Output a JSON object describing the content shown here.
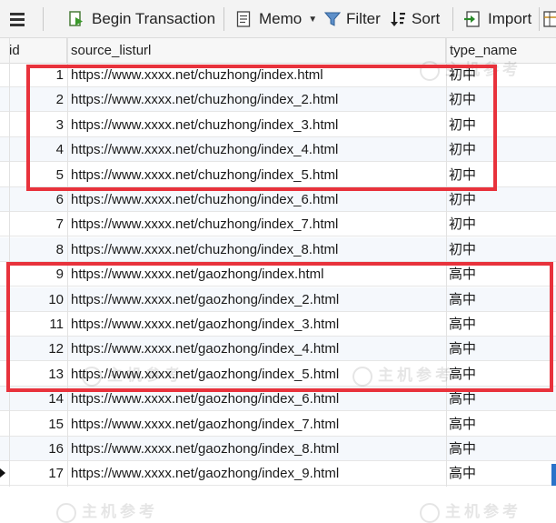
{
  "toolbar": {
    "begin_transaction": "Begin Transaction",
    "memo": "Memo",
    "filter": "Filter",
    "sort": "Sort",
    "import": "Import"
  },
  "columns": [
    "id",
    "source_listurl",
    "type_name"
  ],
  "rows": [
    {
      "id": "1",
      "url": "https://www.xxxx.net/chuzhong/index.html",
      "type": "初中"
    },
    {
      "id": "2",
      "url": "https://www.xxxx.net/chuzhong/index_2.html",
      "type": "初中"
    },
    {
      "id": "3",
      "url": "https://www.xxxx.net/chuzhong/index_3.html",
      "type": "初中"
    },
    {
      "id": "4",
      "url": "https://www.xxxx.net/chuzhong/index_4.html",
      "type": "初中"
    },
    {
      "id": "5",
      "url": "https://www.xxxx.net/chuzhong/index_5.html",
      "type": "初中"
    },
    {
      "id": "6",
      "url": "https://www.xxxx.net/chuzhong/index_6.html",
      "type": "初中"
    },
    {
      "id": "7",
      "url": "https://www.xxxx.net/chuzhong/index_7.html",
      "type": "初中"
    },
    {
      "id": "8",
      "url": "https://www.xxxx.net/chuzhong/index_8.html",
      "type": "初中"
    },
    {
      "id": "9",
      "url": "https://www.xxxx.net/gaozhong/index.html",
      "type": "高中"
    },
    {
      "id": "10",
      "url": "https://www.xxxx.net/gaozhong/index_2.html",
      "type": "高中"
    },
    {
      "id": "11",
      "url": "https://www.xxxx.net/gaozhong/index_3.html",
      "type": "高中"
    },
    {
      "id": "12",
      "url": "https://www.xxxx.net/gaozhong/index_4.html",
      "type": "高中"
    },
    {
      "id": "13",
      "url": "https://www.xxxx.net/gaozhong/index_5.html",
      "type": "高中"
    },
    {
      "id": "14",
      "url": "https://www.xxxx.net/gaozhong/index_6.html",
      "type": "高中"
    },
    {
      "id": "15",
      "url": "https://www.xxxx.net/gaozhong/index_7.html",
      "type": "高中"
    },
    {
      "id": "16",
      "url": "https://www.xxxx.net/gaozhong/index_8.html",
      "type": "高中"
    },
    {
      "id": "17",
      "url": "https://www.xxxx.net/gaozhong/index_9.html",
      "type": "高中"
    }
  ],
  "watermark": "主机参考",
  "colors": {
    "highlight": "#e8323c",
    "selected_accent": "#2b73c9"
  }
}
